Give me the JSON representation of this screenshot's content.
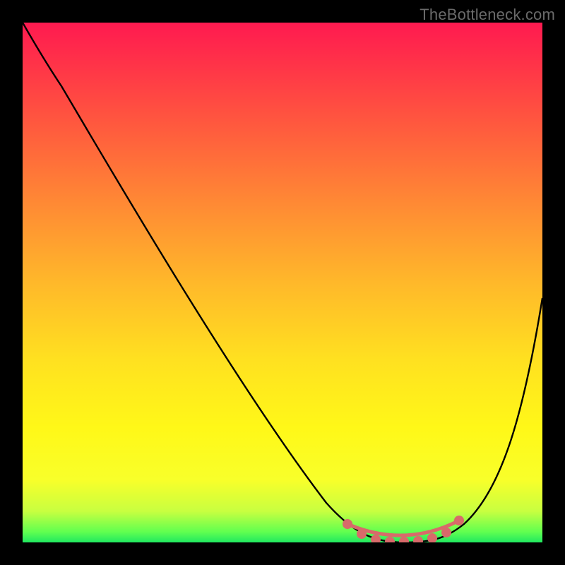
{
  "watermark": "TheBottleneck.com",
  "chart_data": {
    "type": "line",
    "title": "",
    "xlabel": "",
    "ylabel": "",
    "x_range": [
      0,
      100
    ],
    "y_range": [
      0,
      100
    ],
    "gradient": {
      "orientation": "vertical",
      "stops": [
        {
          "pos": 0.0,
          "color": "#ff1a50"
        },
        {
          "pos": 0.5,
          "color": "#ffb82a"
        },
        {
          "pos": 0.88,
          "color": "#f8ff2a"
        },
        {
          "pos": 1.0,
          "color": "#20e860"
        }
      ],
      "meaning": "top=worst (red), bottom=best (green)"
    },
    "series": [
      {
        "name": "bottleneck-curve",
        "color": "#000000",
        "x": [
          0,
          4,
          10,
          20,
          30,
          40,
          50,
          60,
          65,
          70,
          75,
          80,
          85,
          90,
          95,
          100
        ],
        "y": [
          100,
          96,
          88,
          74,
          60,
          46,
          32,
          18,
          10,
          3,
          0,
          0,
          2,
          10,
          28,
          48
        ]
      }
    ],
    "markers": {
      "name": "highlight-band",
      "color": "#d86a6a",
      "x": [
        63,
        66,
        69,
        72,
        74,
        77,
        80,
        82,
        84
      ],
      "y": [
        6,
        3,
        1,
        0.5,
        0.5,
        0.5,
        1,
        2,
        5
      ]
    },
    "annotations": []
  }
}
